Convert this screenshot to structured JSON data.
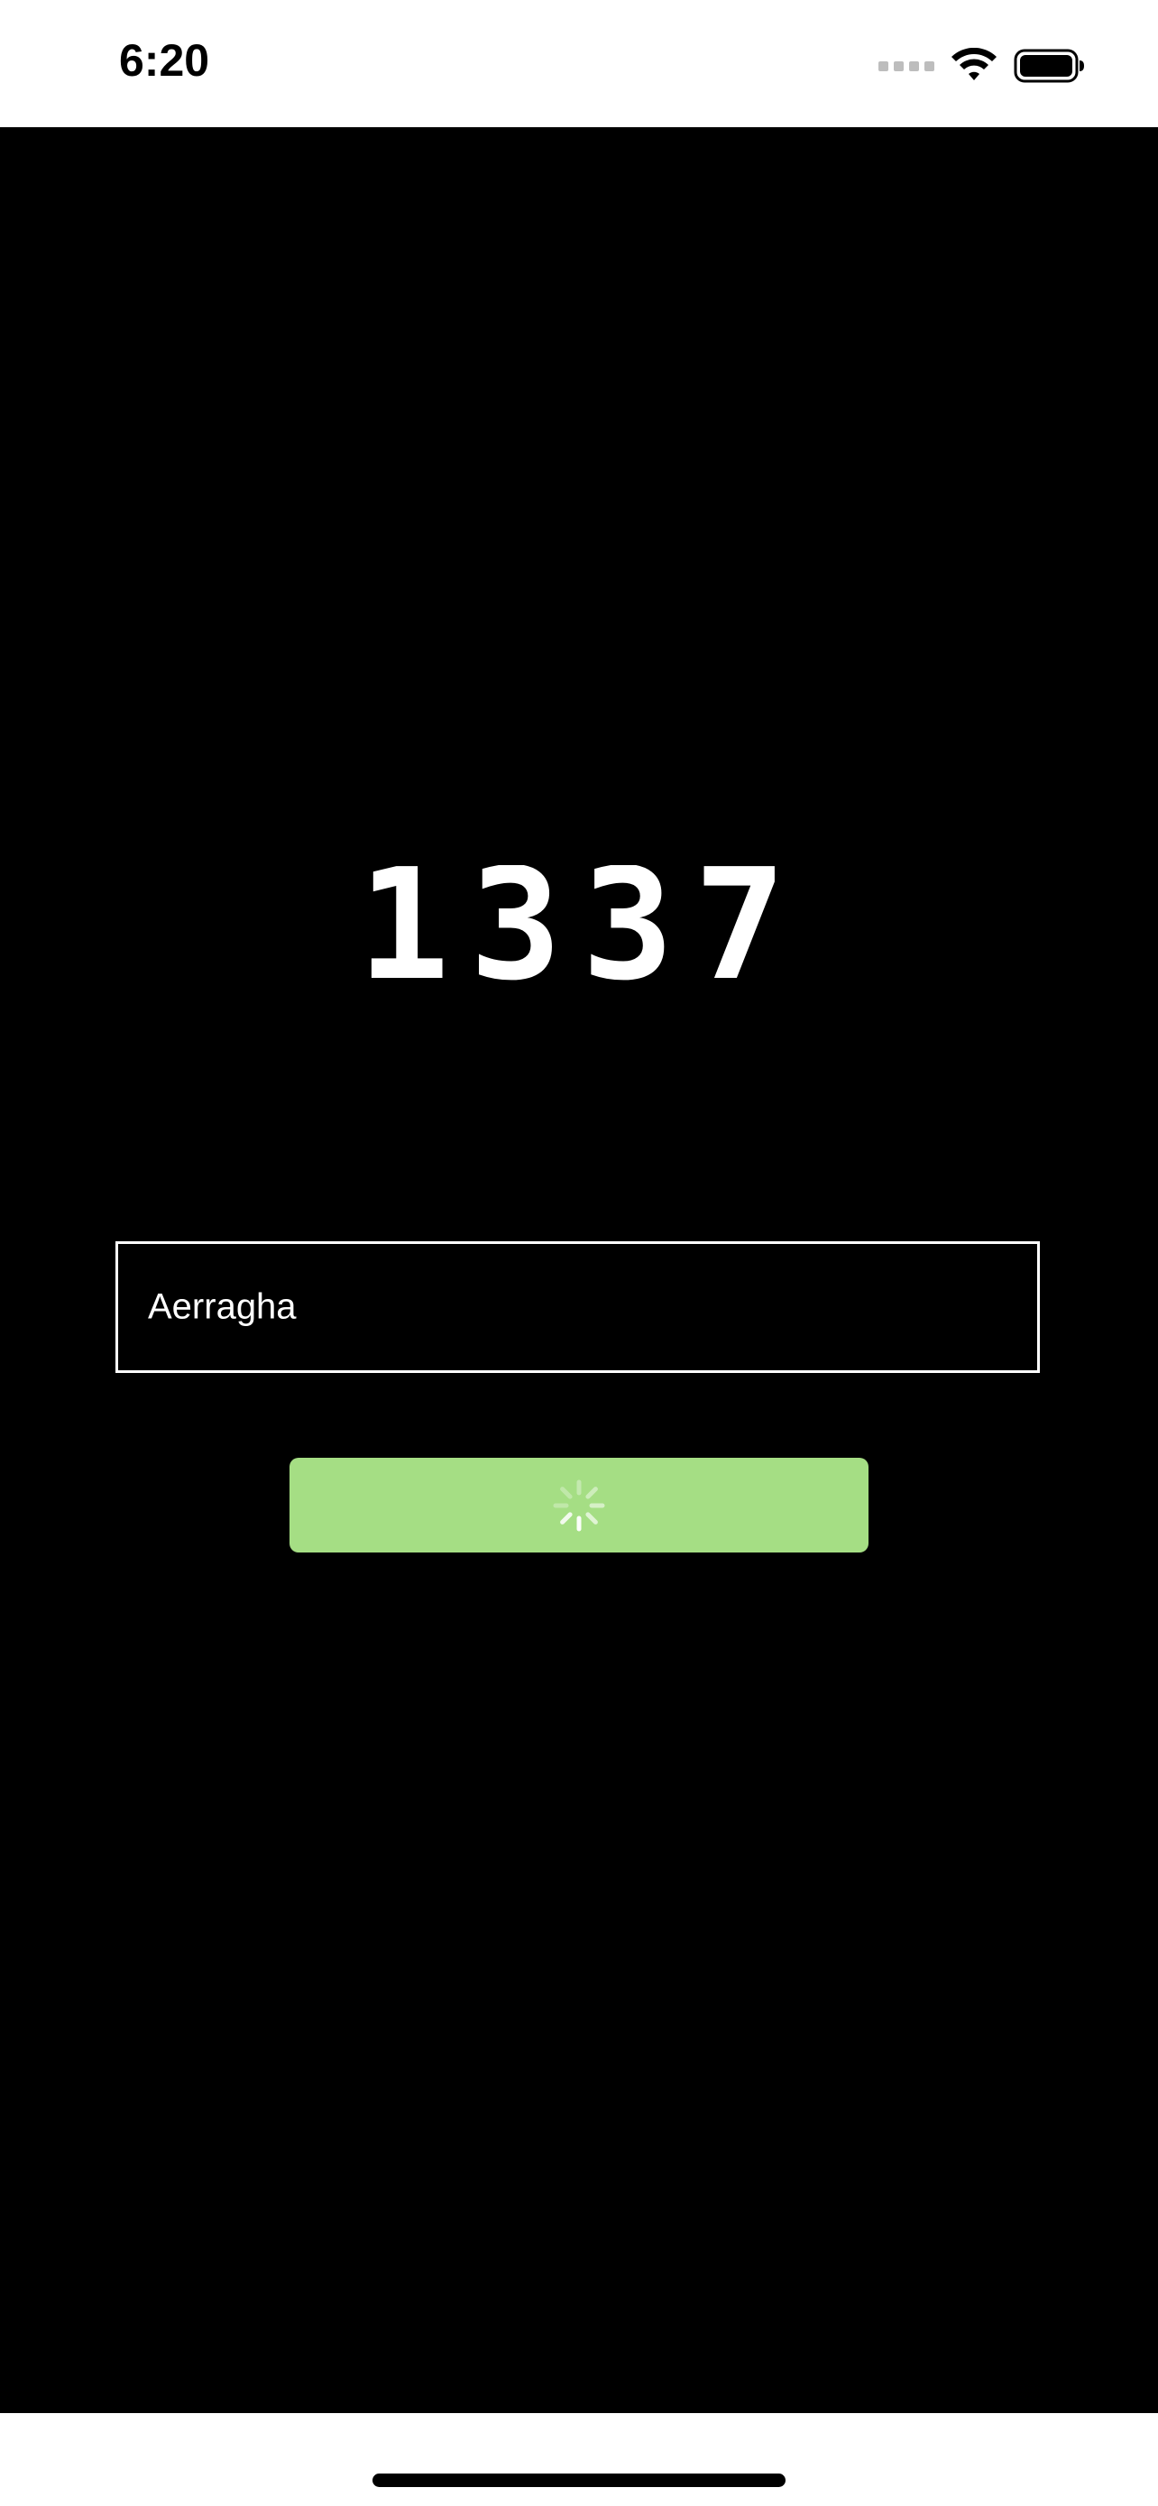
{
  "status_bar": {
    "time": "6:20",
    "icons": [
      "cellular-signal-icon",
      "wifi-icon",
      "battery-icon"
    ]
  },
  "logo": {
    "text": "1337"
  },
  "username_field": {
    "value": "Aerragha"
  },
  "login_button": {
    "state": "loading",
    "icon": "loading-spinner-icon"
  },
  "colors": {
    "background": "#000000",
    "field_border": "#ffffff",
    "button_fill": "#a5de84",
    "text": "#ffffff"
  }
}
